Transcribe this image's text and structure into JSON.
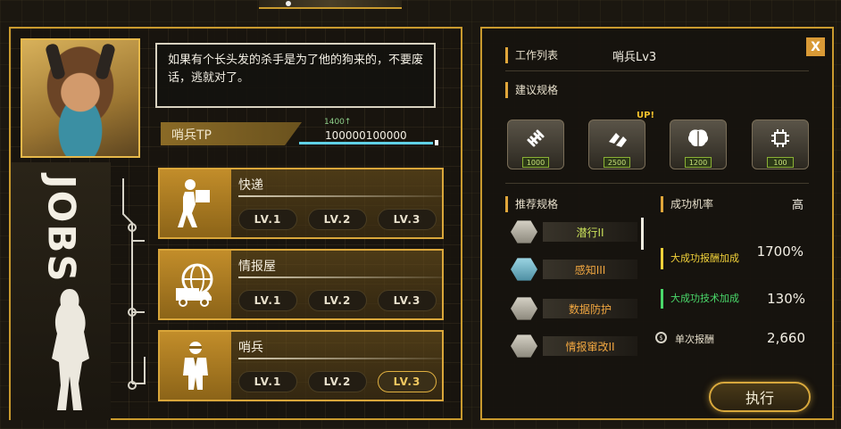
{
  "left": {
    "jobs_banner": "JOBS",
    "dialog_text": "如果有个长头发的杀手是为了他的狗来的，不要废话，逃就对了。",
    "tp": {
      "label": "哨兵TP",
      "delta": "1400↑",
      "value": "100000100000"
    },
    "jobs": [
      {
        "title": "快递",
        "icon": "courier-icon",
        "levels": [
          "LV.1",
          "LV.2",
          "LV.3"
        ],
        "active_level": null
      },
      {
        "title": "情报屋",
        "icon": "globe-truck-icon",
        "levels": [
          "LV.1",
          "LV.2",
          "LV.3"
        ],
        "active_level": null
      },
      {
        "title": "哨兵",
        "icon": "agent-icon",
        "levels": [
          "LV.1",
          "LV.2",
          "LV.3"
        ],
        "active_level": 2
      }
    ]
  },
  "right": {
    "close_label": "X",
    "work_list_label": "工作列表",
    "work_list_value": "哨兵Lv3",
    "suggest_label": "建议规格",
    "up_tag": "UP!",
    "specs": [
      {
        "icon": "dumbbell-icon",
        "value": "1000"
      },
      {
        "icon": "hands-icon",
        "value": "2500"
      },
      {
        "icon": "brain-icon",
        "value": "1200"
      },
      {
        "icon": "chip-icon",
        "value": "100"
      }
    ],
    "recommend_label": "推荐规格",
    "recommend_items": [
      {
        "name": "潜行II",
        "color": "green"
      },
      {
        "name": "感知III",
        "color": "orange"
      },
      {
        "name": "数据防护",
        "color": "orange"
      },
      {
        "name": "情报窜改II",
        "color": "orange"
      }
    ],
    "success_label": "成功机率",
    "success_value": "高",
    "bonus_reward_label": "大成功报酬加成",
    "bonus_reward_value": "1700%",
    "bonus_tech_label": "大成功技术加成",
    "bonus_tech_value": "130%",
    "single_reward_label": "单次报酬",
    "single_reward_value": "2,660",
    "execute_label": "执行"
  },
  "colors": {
    "accent": "#c99a2e",
    "yellow_label": "#f2d23a",
    "green_label": "#4ad86a",
    "tp_line": "#5fd0e6"
  }
}
